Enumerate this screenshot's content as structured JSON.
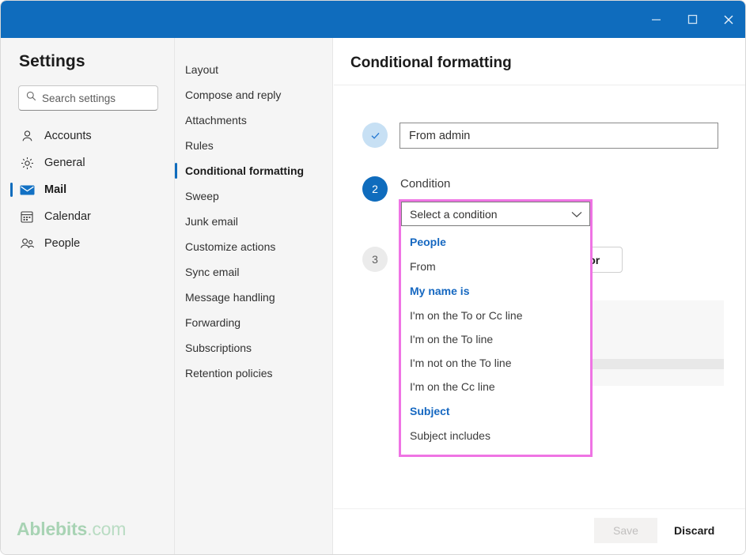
{
  "titlebar": {
    "minimize_label": "Minimize",
    "maximize_label": "Maximize",
    "close_label": "Close",
    "accent_color": "#0f6cbd"
  },
  "sidebar": {
    "title": "Settings",
    "search": {
      "placeholder": "Search settings",
      "value": "",
      "icon": "search-icon"
    },
    "items": [
      {
        "label": "Accounts",
        "icon": "person-icon",
        "selected": false
      },
      {
        "label": "General",
        "icon": "gear-icon",
        "selected": false
      },
      {
        "label": "Mail",
        "icon": "envelope-icon",
        "selected": true
      },
      {
        "label": "Calendar",
        "icon": "calendar-icon",
        "selected": false
      },
      {
        "label": "People",
        "icon": "people-icon",
        "selected": false
      }
    ]
  },
  "midcol": {
    "items": [
      {
        "label": "Layout",
        "selected": false
      },
      {
        "label": "Compose and reply",
        "selected": false
      },
      {
        "label": "Attachments",
        "selected": false
      },
      {
        "label": "Rules",
        "selected": false
      },
      {
        "label": "Conditional formatting",
        "selected": true
      },
      {
        "label": "Sweep",
        "selected": false
      },
      {
        "label": "Junk email",
        "selected": false
      },
      {
        "label": "Customize actions",
        "selected": false
      },
      {
        "label": "Sync email",
        "selected": false
      },
      {
        "label": "Message handling",
        "selected": false
      },
      {
        "label": "Forwarding",
        "selected": false
      },
      {
        "label": "Subscriptions",
        "selected": false
      },
      {
        "label": "Retention policies",
        "selected": false
      }
    ]
  },
  "content": {
    "page_title": "Conditional formatting",
    "step1": {
      "marker": "✓",
      "state": "done",
      "input_value": "From admin"
    },
    "step2": {
      "marker": "2",
      "state": "active",
      "label": "Condition"
    },
    "step3": {
      "marker": "3",
      "state": "idle",
      "color_button_label": "color"
    },
    "dropdown": {
      "selected_text": "Select a condition",
      "chevron": "chevron-down-icon",
      "highlight_color": "#ef74e4",
      "group_color": "#1668c1",
      "options": [
        {
          "type": "group",
          "label": "People"
        },
        {
          "type": "option",
          "label": "From"
        },
        {
          "type": "group",
          "label": "My name is"
        },
        {
          "type": "option",
          "label": "I'm on the To or Cc line"
        },
        {
          "type": "option",
          "label": "I'm on the To line"
        },
        {
          "type": "option",
          "label": "I'm not on the To line"
        },
        {
          "type": "option",
          "label": "I'm on the Cc line"
        },
        {
          "type": "group",
          "label": "Subject"
        },
        {
          "type": "option",
          "label": "Subject includes"
        }
      ]
    }
  },
  "footer": {
    "save_label": "Save",
    "save_disabled": true,
    "discard_label": "Discard"
  },
  "watermark": {
    "brand": "Ablebits",
    "tld": ".com"
  }
}
